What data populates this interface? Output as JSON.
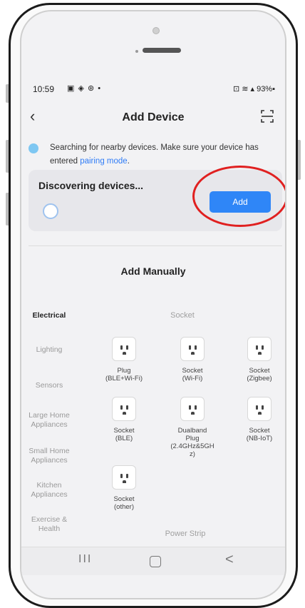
{
  "status_bar": {
    "time": "10:59",
    "left_icons": "▣ ◈ ⊛ •",
    "right_text": "⊡ ≋ ▴ 93%▪"
  },
  "header": {
    "title": "Add Device",
    "back_icon": "chevron-left",
    "scan_icon": "scan-frame"
  },
  "search_notice": {
    "text": "Searching for nearby devices. Make sure your device has entered ",
    "link": "pairing mode",
    "suffix": "."
  },
  "discovery": {
    "title": "Discovering devices...",
    "add_label": "Add"
  },
  "add_manually": {
    "title": "Add Manually"
  },
  "categories": [
    {
      "label": "Electrical",
      "active": true
    },
    {
      "label": "Lighting",
      "active": false
    },
    {
      "label": "Sensors",
      "active": false
    },
    {
      "label": "Large Home Appliances",
      "active": false
    },
    {
      "label": "Small Home Appliances",
      "active": false
    },
    {
      "label": "Kitchen Appliances",
      "active": false
    },
    {
      "label": "Exercise & Health",
      "active": false
    }
  ],
  "sections": {
    "socket": "Socket",
    "power_strip": "Power Strip"
  },
  "products": [
    {
      "label_1": "Plug",
      "label_2": "(BLE+Wi-Fi)"
    },
    {
      "label_1": "Socket",
      "label_2": "(Wi-Fi)"
    },
    {
      "label_1": "Socket",
      "label_2": "(Zigbee)"
    },
    {
      "label_1": "Socket",
      "label_2": "(BLE)"
    },
    {
      "label_1": "Dualband",
      "label_2": "Plug",
      "label_3": "(2.4GHz&5GH",
      "label_4": "z)"
    },
    {
      "label_1": "Socket",
      "label_2": "(NB-IoT)"
    },
    {
      "label_1": "Socket",
      "label_2": "(other)"
    }
  ],
  "nav_bar": {
    "recent": "III",
    "back": "<"
  },
  "colors": {
    "accent": "#2f86f7",
    "highlight_circle": "#e02020",
    "card_bg": "#e7e7eb"
  }
}
